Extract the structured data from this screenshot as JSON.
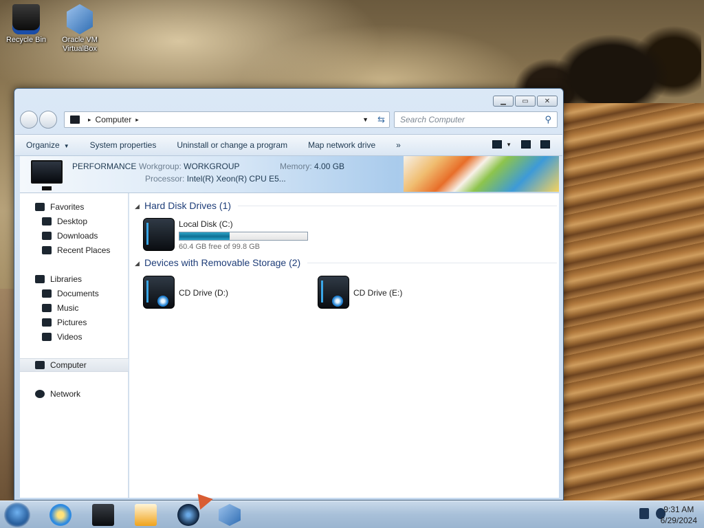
{
  "desktop": {
    "icons": [
      {
        "label": "Recycle Bin"
      },
      {
        "label_line1": "Oracle VM",
        "label_line2": "VirtualBox"
      }
    ]
  },
  "window": {
    "address": {
      "location": "Computer",
      "separator": "▸"
    },
    "search": {
      "placeholder": "Search Computer"
    },
    "toolbar": {
      "organize": "Organize",
      "system_properties": "System properties",
      "uninstall": "Uninstall or change a program",
      "map_drive": "Map network drive",
      "more": "»"
    },
    "details": {
      "computer_name": "PERFORMANCE",
      "workgroup_label": "Workgroup:",
      "workgroup_value": "WORKGROUP",
      "memory_label": "Memory:",
      "memory_value": "4.00 GB",
      "processor_label": "Processor:",
      "processor_value": "Intel(R) Xeon(R) CPU E5..."
    },
    "sidebar": {
      "favorites": "Favorites",
      "desktop": "Desktop",
      "downloads": "Downloads",
      "recent_places": "Recent Places",
      "libraries": "Libraries",
      "documents": "Documents",
      "music": "Music",
      "pictures": "Pictures",
      "videos": "Videos",
      "computer": "Computer",
      "network": "Network"
    },
    "content": {
      "hdd_group": "Hard Disk Drives (1)",
      "local_disk": {
        "name": "Local Disk (C:)",
        "free": "60.4 GB free of 99.8 GB",
        "used_fraction": 0.395
      },
      "removable_group": "Devices with Removable Storage (2)",
      "cd_d": "CD Drive (D:)",
      "cd_e": "CD Drive (E:)"
    }
  },
  "taskbar": {
    "clock_time": "9:31 AM",
    "clock_date": "6/29/2024"
  }
}
